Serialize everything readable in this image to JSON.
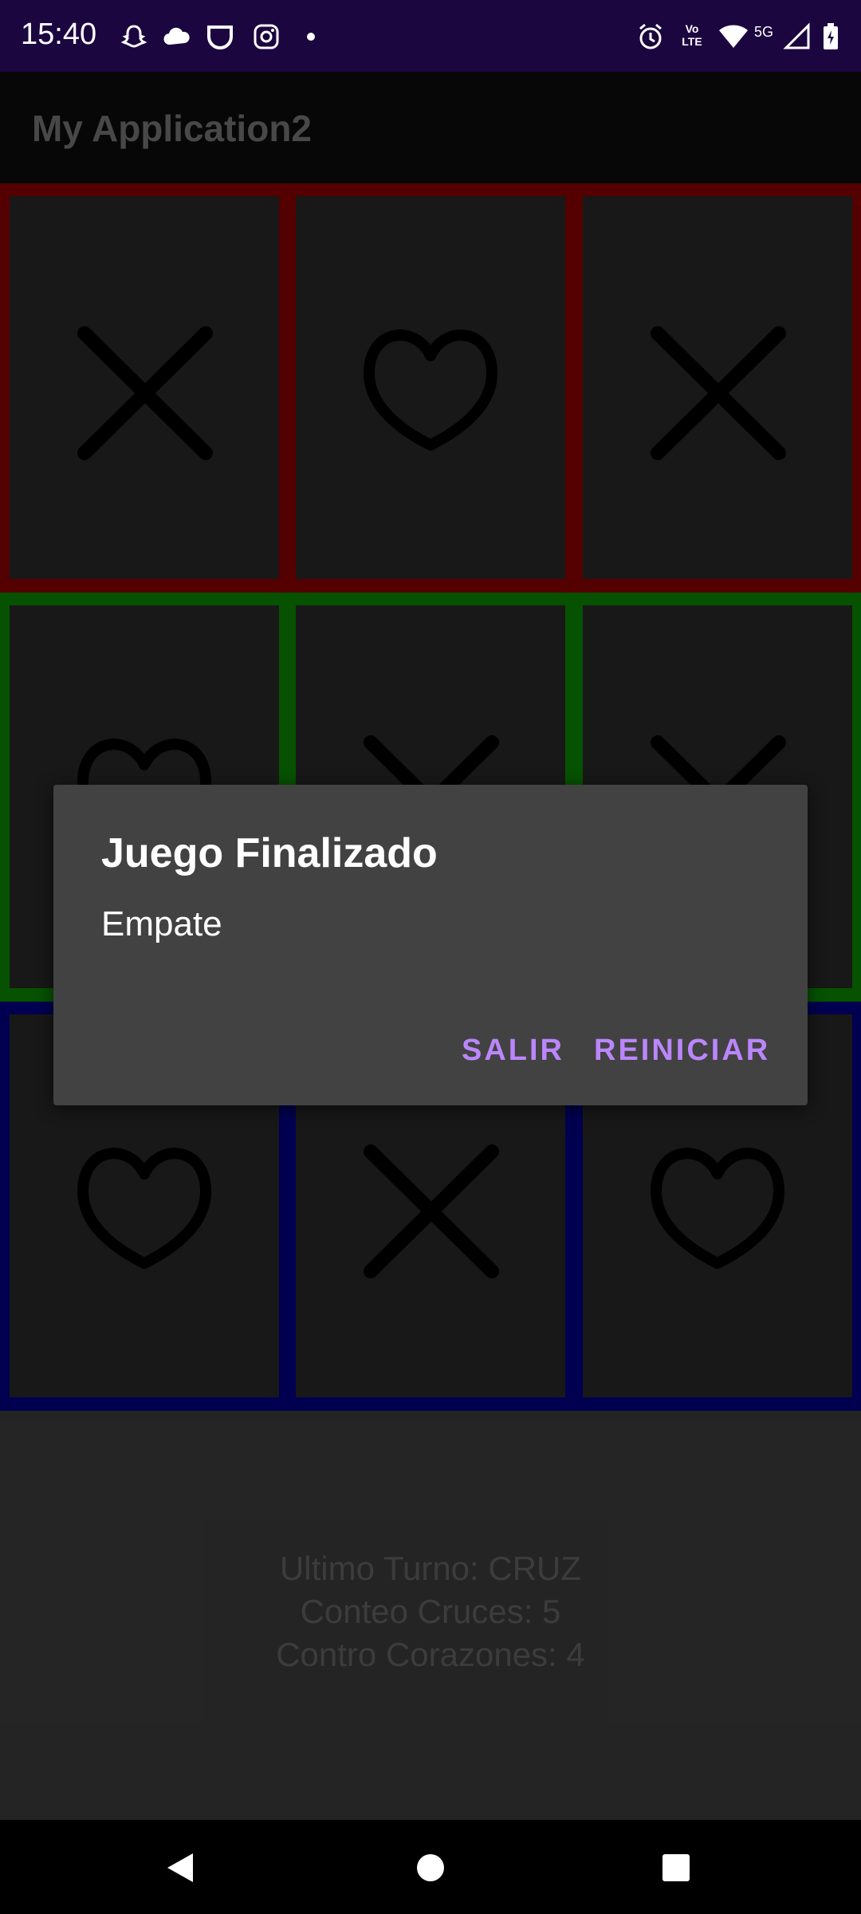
{
  "status_bar": {
    "time": "15:40",
    "network_type": "5G",
    "volte_label": "Vo LTE",
    "icons": [
      "snapchat-icon",
      "cloud-icon",
      "shield-icon",
      "instagram-icon",
      "dot-icon",
      "alarm-icon",
      "volte-icon",
      "wifi-icon",
      "signal-icon",
      "battery-icon"
    ]
  },
  "app_bar": {
    "title": "My Application2"
  },
  "board": {
    "rows": [
      {
        "color": "#7c0000",
        "cells": [
          "cross",
          "heart",
          "cross"
        ]
      },
      {
        "color": "#0a7a00",
        "cells": [
          "heart",
          "cross",
          "cross"
        ]
      },
      {
        "color": "#020077",
        "cells": [
          "heart",
          "cross",
          "heart"
        ]
      }
    ]
  },
  "info": {
    "last_turn": "Ultimo Turno: CRUZ",
    "cross_count": "Conteo Cruces: 5",
    "heart_count": "Contro Corazones: 4"
  },
  "dialog": {
    "title": "Juego Finalizado",
    "message": "Empate",
    "exit_label": "SALIR",
    "restart_label": "REINICIAR",
    "accent": "#bb86fc"
  },
  "nav_bar": {
    "icons": [
      "back-icon",
      "home-icon",
      "recents-icon"
    ]
  }
}
